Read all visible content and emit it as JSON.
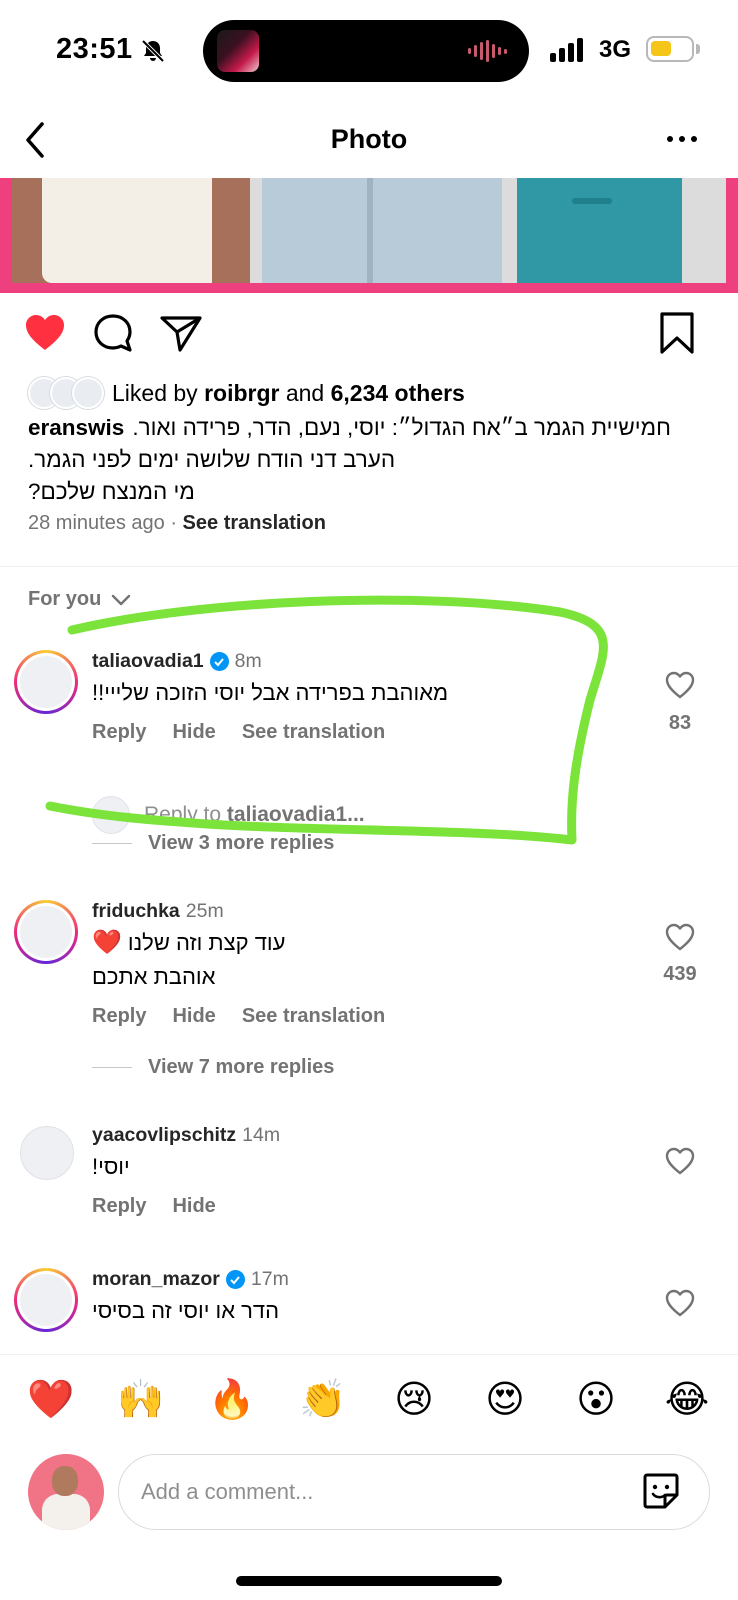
{
  "status": {
    "time": "23:51",
    "network": "3G"
  },
  "header": {
    "title": "Photo"
  },
  "likes": {
    "prefix": "Liked by",
    "user": "roibrgr",
    "conj": "and",
    "others": "6,234 others"
  },
  "post": {
    "author": "eranswis",
    "caption_line1": "חמישיית הגמר ב״אח הגדול״: יוסי, נעם, הדר, פרידה ואור.",
    "caption_line2": "הערב דני הודח שלושה ימים לפני הגמר.",
    "caption_line3": "מי המנצח שלכם?",
    "time_ago": "28 minutes ago",
    "see_translation": "See translation"
  },
  "sort": {
    "label": "For you"
  },
  "comments": [
    {
      "user": "taliaovadia1",
      "verified": true,
      "ago": "8m",
      "text": "מאוהבת בפרידה אבל יוסי הזוכה שלייי!!",
      "likes": "83",
      "reply": "Reply",
      "hide": "Hide",
      "translate": "See translation",
      "reply_prompt": "Reply to",
      "reply_user": "taliaovadia1...",
      "view_more": "View 3 more replies"
    },
    {
      "user": "friduchka",
      "verified": false,
      "ago": "25m",
      "text_line1": "עוד קצת וזה שלנו",
      "text_line2": "אוהבת אתכם",
      "likes": "439",
      "reply": "Reply",
      "hide": "Hide",
      "translate": "See translation",
      "view_more": "View 7 more replies"
    },
    {
      "user": "yaacovlipschitz",
      "verified": false,
      "ago": "14m",
      "text": "יוסי!",
      "reply": "Reply",
      "hide": "Hide"
    },
    {
      "user": "moran_mazor",
      "verified": true,
      "ago": "17m",
      "text": "הדר או יוסי זה בסיסי"
    }
  ],
  "emoji_bar": [
    "❤️",
    "🙌",
    "🔥",
    "👏",
    "😢",
    "😍",
    "😮",
    "😂"
  ],
  "composer": {
    "placeholder": "Add a comment..."
  },
  "colors": {
    "like_red": "#ff3040",
    "highlight_green": "#7be33a",
    "link_blue": "#0095f6",
    "photo_border": "#ee3f7e"
  }
}
